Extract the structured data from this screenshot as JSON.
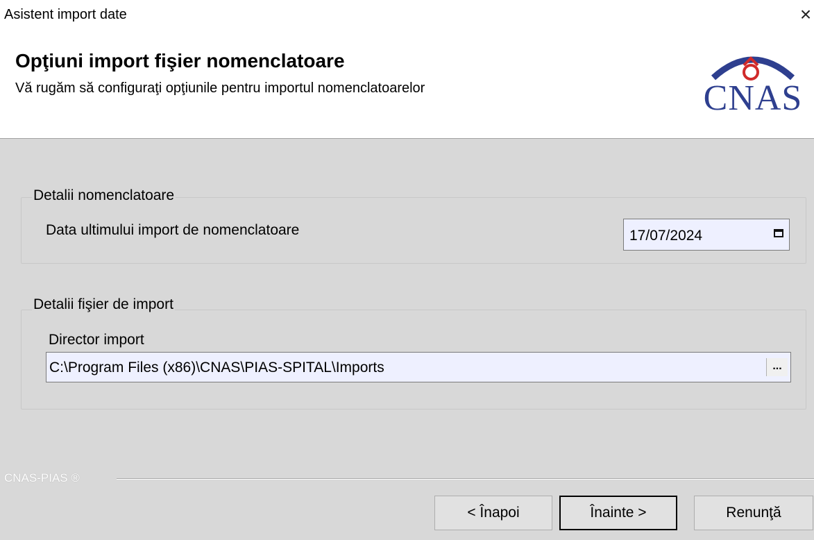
{
  "window": {
    "title": "Asistent import date"
  },
  "header": {
    "title": "Opţiuni import fişier nomenclatoare",
    "subtitle": "Vă rugăm să configuraţi opţiunile pentru importul nomenclatoarelor",
    "logo_text": "CNAS"
  },
  "nomenclature_group": {
    "legend": "Detalii nomenclatoare",
    "date_label": "Data ultimului import de nomenclatoare",
    "date_value": "17/07/2024"
  },
  "import_group": {
    "legend": "Detalii fişier de import",
    "dir_label": "Director import",
    "dir_value": "C:\\Program Files (x86)\\CNAS\\PIAS-SPITAL\\Imports",
    "browse_label": "..."
  },
  "footer": {
    "brand": "CNAS-PIAS ®",
    "back_label": "< Înapoi",
    "next_label": "Înainte >",
    "cancel_label": "Renunţă"
  },
  "colors": {
    "logo": "#2e3f8f",
    "field_bg": "#eef0ff",
    "panel_bg": "#d8d8d8"
  }
}
